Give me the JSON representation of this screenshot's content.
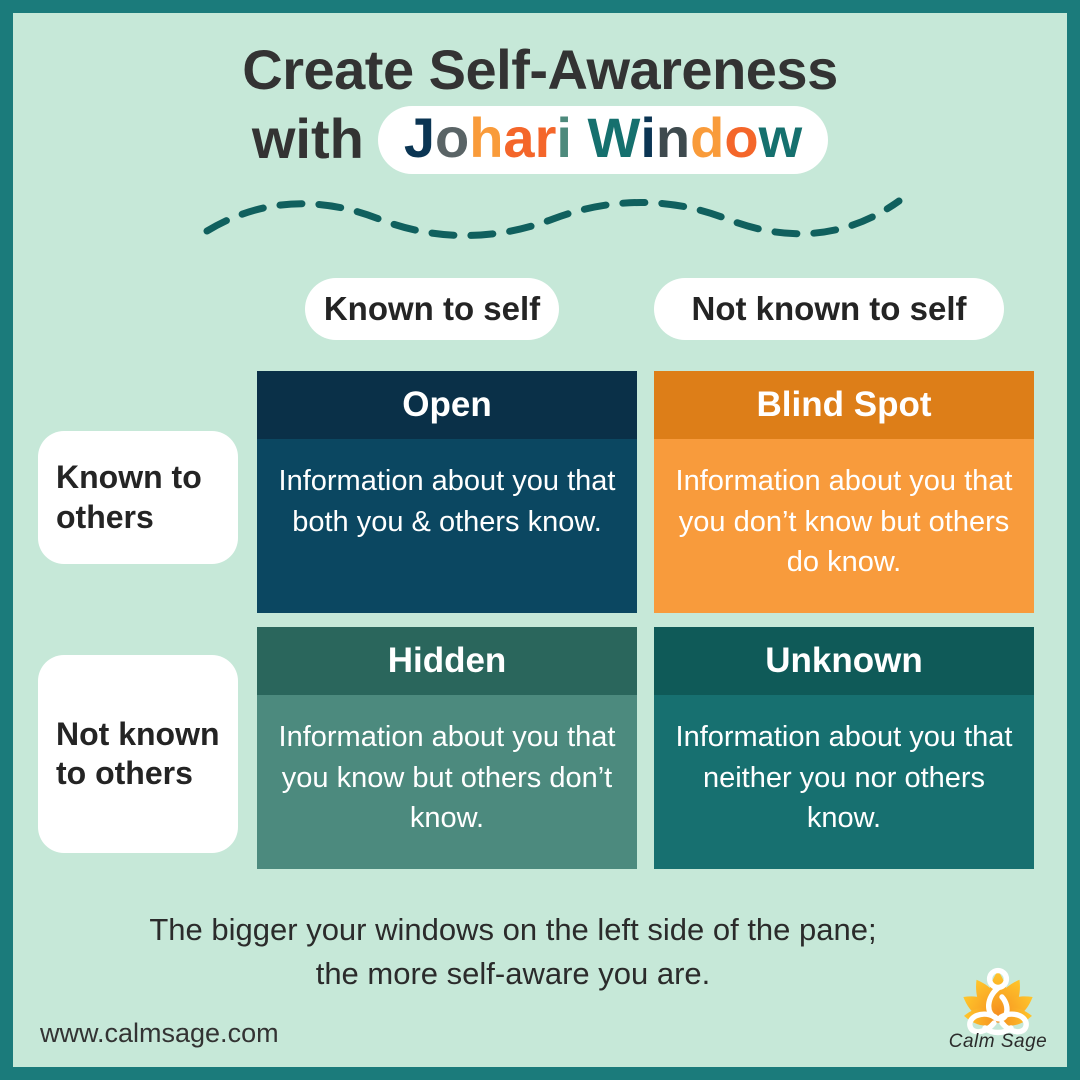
{
  "theme": {
    "border_color": "#1B7B7B",
    "background_color": "#C6E8D8",
    "pill_bg": "#FFFFFF",
    "heading_color": "#333333",
    "wave_color": "#10605E"
  },
  "header": {
    "title_line1": "Create Self-Awareness",
    "title_line2_prefix": "with",
    "brand_letters": [
      {
        "char": "J",
        "color": "#0B3553"
      },
      {
        "char": "o",
        "color": "#5A6466"
      },
      {
        "char": "h",
        "color": "#F99B3A"
      },
      {
        "char": "a",
        "color": "#F4662A"
      },
      {
        "char": "r",
        "color": "#F4662A"
      },
      {
        "char": "i",
        "color": "#4D8A7C"
      },
      {
        "char": " ",
        "color": "#FFFFFF"
      },
      {
        "char": "W",
        "color": "#15706E"
      },
      {
        "char": "i",
        "color": "#0B3553"
      },
      {
        "char": "n",
        "color": "#3E4A4E"
      },
      {
        "char": "d",
        "color": "#F99B3A"
      },
      {
        "char": "o",
        "color": "#F4662A"
      },
      {
        "char": "w",
        "color": "#15706E"
      }
    ],
    "brand_text": "Johari Window"
  },
  "matrix": {
    "column_labels": [
      {
        "id": "known-self",
        "label": "Known to self"
      },
      {
        "id": "notknown-self",
        "label": "Not known to self"
      }
    ],
    "row_labels": [
      {
        "id": "known-others",
        "label": "Known to others"
      },
      {
        "id": "notknown-others",
        "label": "Not known to others"
      }
    ],
    "quadrants": [
      {
        "id": "open",
        "title": "Open",
        "body": "Information about you that both you & others know.",
        "header_color": "#0A3048",
        "body_color": "#0B4761",
        "text_color": "#FFFFFF"
      },
      {
        "id": "blind-spot",
        "title": "Blind Spot",
        "body": "Information about you that you don’t know but others do know.",
        "header_color": "#DD7E18",
        "body_color": "#F89B3C",
        "text_color": "#FFFFFF"
      },
      {
        "id": "hidden",
        "title": "Hidden",
        "body": "Information about you that you know but others don’t know.",
        "header_color": "#2A665C",
        "body_color": "#4C8A7E",
        "text_color": "#FFFFFF"
      },
      {
        "id": "unknown",
        "title": "Unknown",
        "body": "Information about you that neither you nor others know.",
        "header_color": "#0F5A58",
        "body_color": "#177070",
        "text_color": "#FFFFFF"
      }
    ]
  },
  "caption": {
    "line1": "The bigger your windows on the left side of the pane;",
    "line2": "the more self-aware you are."
  },
  "footer": {
    "website": "www.calmsage.com",
    "logo_name": "Calm Sage",
    "logo_icon": "lotus-meditation-icon",
    "logo_color_start": "#FFC62B",
    "logo_color_end": "#F4871F"
  }
}
